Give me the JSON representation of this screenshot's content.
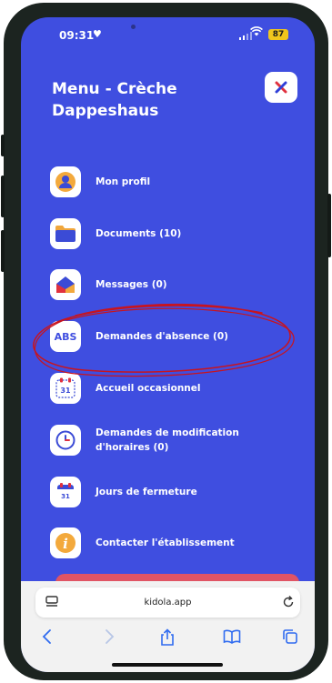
{
  "status_bar": {
    "time": "09:31",
    "battery": "87"
  },
  "menu": {
    "title": "Menu - Crèche Dappeshaus",
    "items": [
      {
        "label": "Mon profil",
        "icon": "profile-icon"
      },
      {
        "label": "Documents (10)",
        "icon": "folder-icon"
      },
      {
        "label": "Messages (0)",
        "icon": "messages-icon"
      },
      {
        "label": "Demandes d'absence (0)",
        "icon": "abs-icon",
        "icon_text": "ABS"
      },
      {
        "label": "Accueil occasionnel",
        "icon": "calendar-icon",
        "icon_text": "31"
      },
      {
        "label": "Demandes de modification d'horaires (0)",
        "icon": "clock-icon"
      },
      {
        "label": "Jours de fermeture",
        "icon": "calendar-closed-icon",
        "icon_text": "31"
      },
      {
        "label": "Contacter l'établissement",
        "icon": "info-icon",
        "icon_text": "i"
      }
    ]
  },
  "browser": {
    "url": "kidola.app"
  },
  "colors": {
    "background": "#3f4ee0",
    "highlight_circle": "#c8141e",
    "close_x": "#e0313f",
    "bottom_button": "#e05464"
  }
}
